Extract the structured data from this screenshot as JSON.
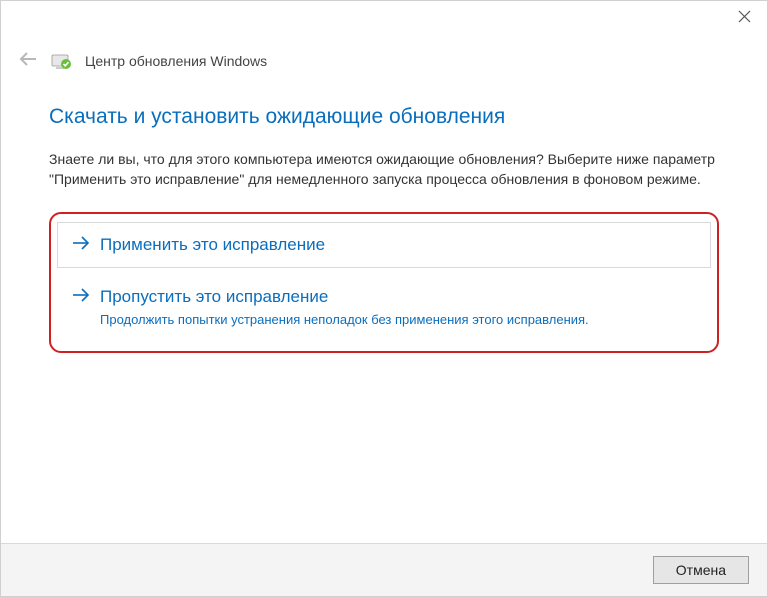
{
  "header": {
    "title": "Центр обновления Windows"
  },
  "main": {
    "heading": "Скачать и установить ожидающие обновления",
    "description": "Знаете ли вы, что для этого компьютера имеются ожидающие обновления? Выберите ниже параметр \"Применить это исправление\" для немедленного запуска процесса обновления в фоновом режиме."
  },
  "options": {
    "apply": {
      "title": "Применить это исправление"
    },
    "skip": {
      "title": "Пропустить это исправление",
      "subtitle": "Продолжить попытки устранения неполадок без применения этого исправления."
    }
  },
  "footer": {
    "cancel_label": "Отмена"
  }
}
